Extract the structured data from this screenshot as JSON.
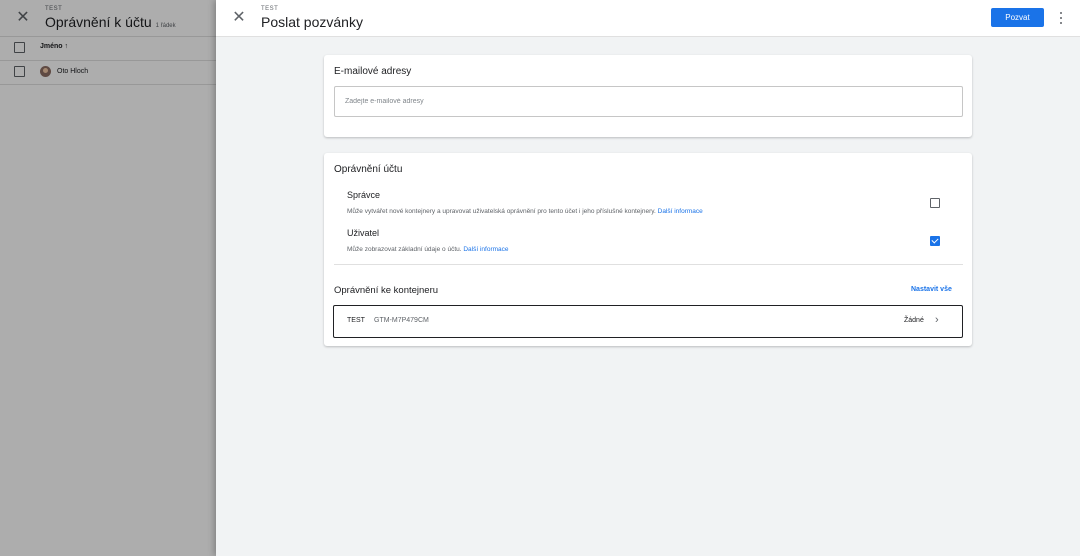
{
  "background": {
    "breadcrumb": "TEST",
    "title": "Oprávnění k účtu",
    "row_count": "1 řádek",
    "column_name": "Jméno ↑",
    "users": [
      {
        "name": "Oto Hloch"
      }
    ]
  },
  "topbar": {
    "breadcrumb": "TEST",
    "title": "Poslat pozvánky",
    "invite_label": "Pozvat"
  },
  "emails": {
    "title": "E-mailové adresy",
    "placeholder": "Zadejte e-mailové adresy"
  },
  "account_permissions": {
    "title": "Oprávnění účtu",
    "roles": [
      {
        "name": "Správce",
        "description": "Může vytvářet nové kontejnery a upravovat uživatelská oprávnění pro tento účet i jeho příslušné kontejnery.",
        "link": "Další informace",
        "checked": false
      },
      {
        "name": "Uživatel",
        "description": "Může zobrazovat základní údaje o účtu.",
        "link": "Další informace",
        "checked": true
      }
    ]
  },
  "container_permissions": {
    "title": "Oprávnění ke kontejneru",
    "set_all": "Nastavit vše",
    "containers": [
      {
        "name": "TEST",
        "id": "GTM-M7P479CM",
        "permission": "Žádné"
      }
    ]
  },
  "colors": {
    "accent": "#1a73e8",
    "text": "#202124",
    "muted": "#5f6368",
    "background": "#f1f3f4"
  }
}
